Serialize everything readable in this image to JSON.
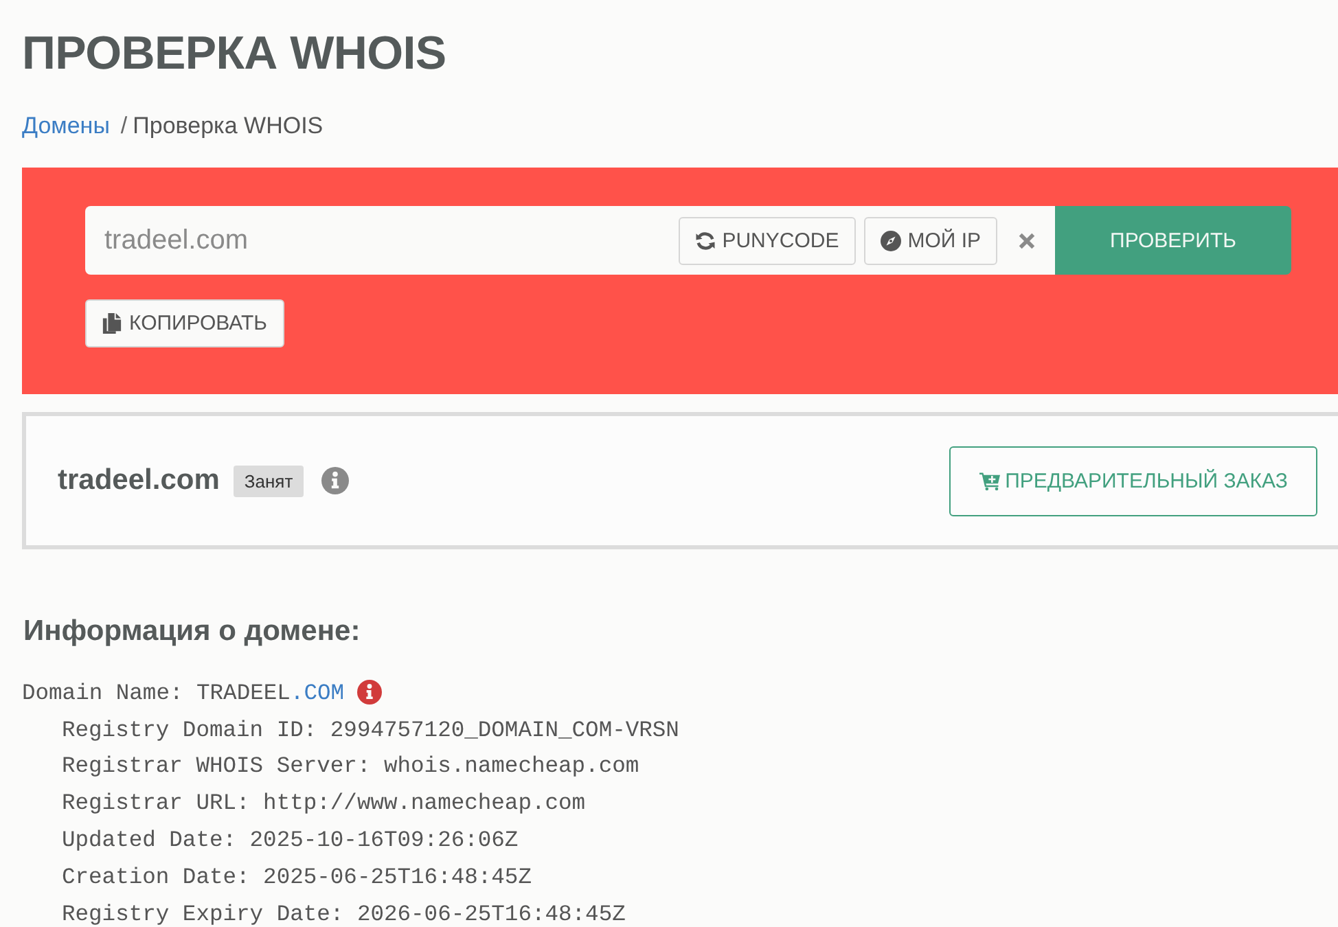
{
  "page_title": "ПРОВЕРКА WHOIS",
  "breadcrumbs": [
    {
      "label": "Домены",
      "kind": "link"
    },
    {
      "separator": "/",
      "label": "Проверка WHOIS",
      "kind": "current"
    }
  ],
  "search": {
    "value": "tradeel.com",
    "punycode_button": "PUNYCODE",
    "my_ip_button": "МОЙ IP",
    "submit_button": "ПРОВЕРИТЬ",
    "copy_button": "КОПИРОВАТЬ"
  },
  "result": {
    "domain": "tradeel.com",
    "status": "Занят",
    "preorder_button": "ПРЕДВАРИТЕЛЬНЫЙ ЗАКАЗ"
  },
  "info_heading": "Информация о домене:",
  "whois": [
    {
      "text": "Domain Name: TRADEEL",
      "link": ".COM",
      "children": [
        {
          "text": "Registry Domain ID: 2994757120_DOMAIN_COM-VRSN"
        },
        {
          "text": "Registrar WHOIS Server: whois.namecheap.com"
        },
        {
          "text": "Registrar URL: http://www.namecheap.com"
        },
        {
          "text": "Updated Date: 2025-10-16T09:26:06Z"
        },
        {
          "text": "Creation Date: 2025-06-25T16:48:45Z"
        },
        {
          "text": "Registry Expiry Date: 2026-06-25T16:48:45Z"
        }
      ]
    }
  ]
}
